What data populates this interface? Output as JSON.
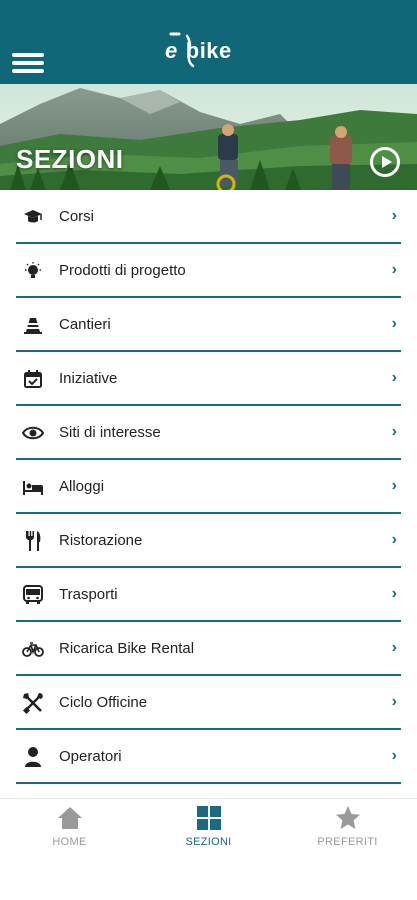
{
  "header": {
    "menu_icon": "hamburger-menu-icon",
    "logo_prefix": "e",
    "logo_suffix": "bike",
    "brand_color": "#0f6777"
  },
  "banner": {
    "title": "SEZIONI",
    "play_icon": "play-circle-icon"
  },
  "sections": [
    {
      "label": "Corsi",
      "icon": "graduation-cap-icon"
    },
    {
      "label": "Prodotti di progetto",
      "icon": "lightbulb-icon"
    },
    {
      "label": "Cantieri",
      "icon": "traffic-cone-icon"
    },
    {
      "label": "Iniziative",
      "icon": "calendar-check-icon"
    },
    {
      "label": "Siti di interesse",
      "icon": "eye-icon"
    },
    {
      "label": "Alloggi",
      "icon": "bed-icon"
    },
    {
      "label": "Ristorazione",
      "icon": "fork-knife-icon"
    },
    {
      "label": "Trasporti",
      "icon": "bus-icon"
    },
    {
      "label": "Ricarica Bike Rental",
      "icon": "bicycle-icon"
    },
    {
      "label": "Ciclo Officine",
      "icon": "tools-icon"
    },
    {
      "label": "Operatori",
      "icon": "person-icon"
    }
  ],
  "chevron": "›",
  "tabs": [
    {
      "label": "HOME",
      "icon": "home-icon",
      "active": false
    },
    {
      "label": "SEZIONI",
      "icon": "grid-icon",
      "active": true
    },
    {
      "label": "PREFERITI",
      "icon": "star-icon",
      "active": false
    }
  ],
  "colors": {
    "accent": "#1a6a82",
    "inactive": "#9a9a9a"
  }
}
